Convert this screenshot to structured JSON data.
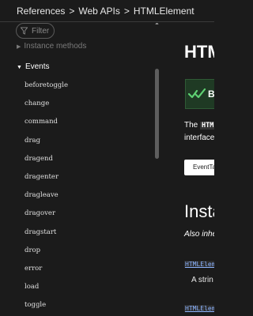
{
  "breadcrumbs": [
    "References",
    "Web APIs",
    "HTMLElement"
  ],
  "breadcrumb_separator": ">",
  "sidebar": {
    "filter_placeholder": "Filter",
    "instance_methods_label": "Instance methods",
    "events_label": "Events",
    "events": [
      "beforetoggle",
      "change",
      "command",
      "drag",
      "dragend",
      "dragenter",
      "dragleave",
      "dragover",
      "dragstart",
      "drop",
      "error",
      "load",
      "toggle"
    ]
  },
  "main": {
    "title": "HTML",
    "badge_text": "B",
    "intro_prefix": "The",
    "intro_code": "HTML",
    "intro_line2": "interface",
    "button_label": "EventTa",
    "section_title": "Insta",
    "italic_text": "Also inhe",
    "link1": "HTMLElem",
    "desc_text": "A strin",
    "link2": "HTMLElem"
  },
  "colors": {
    "background": "#1b1b1b",
    "badge_bg": "#1f3a24",
    "badge_icon": "#5fd173",
    "link": "#8cb4ff"
  }
}
